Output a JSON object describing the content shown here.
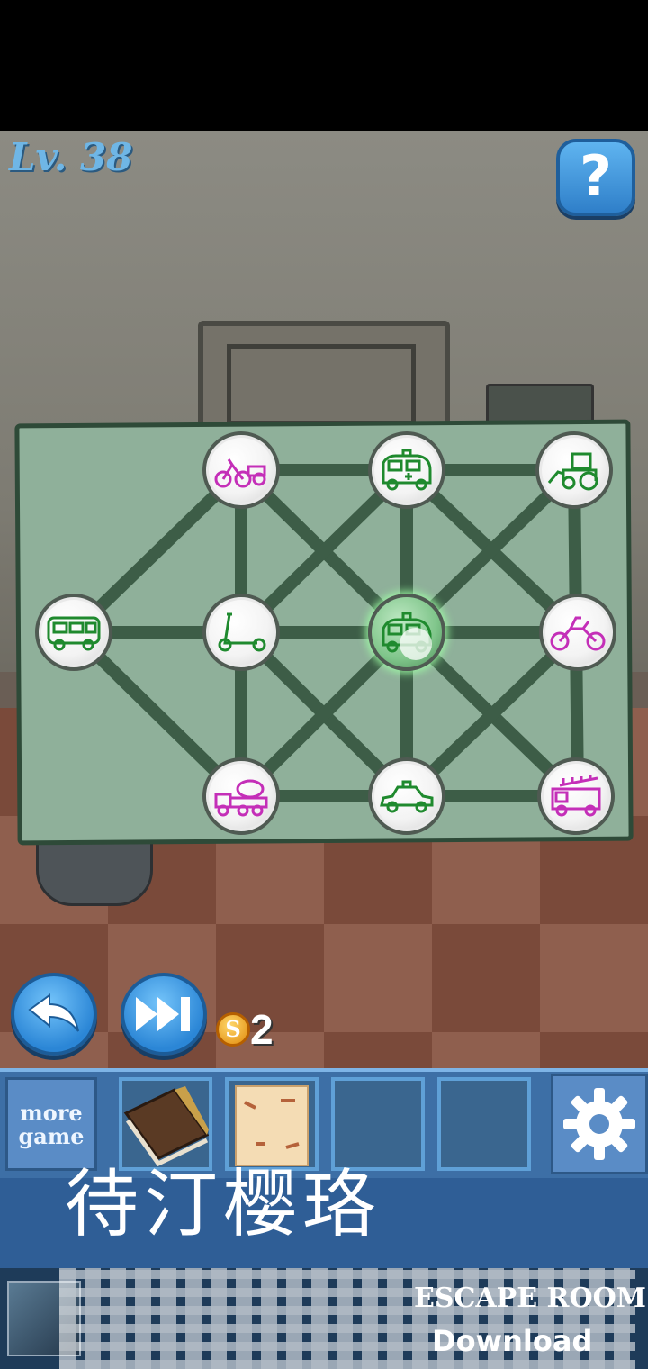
{
  "level": {
    "label": "Lv. 38"
  },
  "help_button": {
    "label": "?"
  },
  "puzzle": {
    "nodes": [
      {
        "id": "bicycle-cart",
        "icon": "bicycle-cart-icon",
        "color": "#c42fb8"
      },
      {
        "id": "ambulance",
        "icon": "ambulance-icon",
        "color": "#1f8a2e"
      },
      {
        "id": "road-roller",
        "icon": "road-roller-icon",
        "color": "#1f8a2e"
      },
      {
        "id": "bus",
        "icon": "bus-icon",
        "color": "#1f8a2e"
      },
      {
        "id": "scooter",
        "icon": "scooter-icon",
        "color": "#1f8a2e"
      },
      {
        "id": "police-car",
        "icon": "police-car-icon",
        "color": "#1f8a2e",
        "selected": true
      },
      {
        "id": "motorcycle",
        "icon": "motorcycle-icon",
        "color": "#c42fb8"
      },
      {
        "id": "cement-mixer",
        "icon": "cement-mixer-icon",
        "color": "#c42fb8"
      },
      {
        "id": "taxi",
        "icon": "taxi-icon",
        "color": "#1f8a2e"
      },
      {
        "id": "fire-truck",
        "icon": "fire-truck-icon",
        "color": "#c42fb8"
      }
    ]
  },
  "controls": {
    "undo_icon": "undo-arrow-icon",
    "skip_icon": "skip-forward-icon",
    "coin_symbol": "S",
    "coin_count": "2"
  },
  "toolbar": {
    "more_game_line1": "more",
    "more_game_line2": "game",
    "inventory": [
      "book-item",
      "paper-note-item",
      "empty",
      "empty"
    ],
    "settings_icon": "gear-icon"
  },
  "watermark": "待汀樱珞",
  "ad": {
    "title": "ESCAPE ROOM",
    "sub": "Download"
  }
}
